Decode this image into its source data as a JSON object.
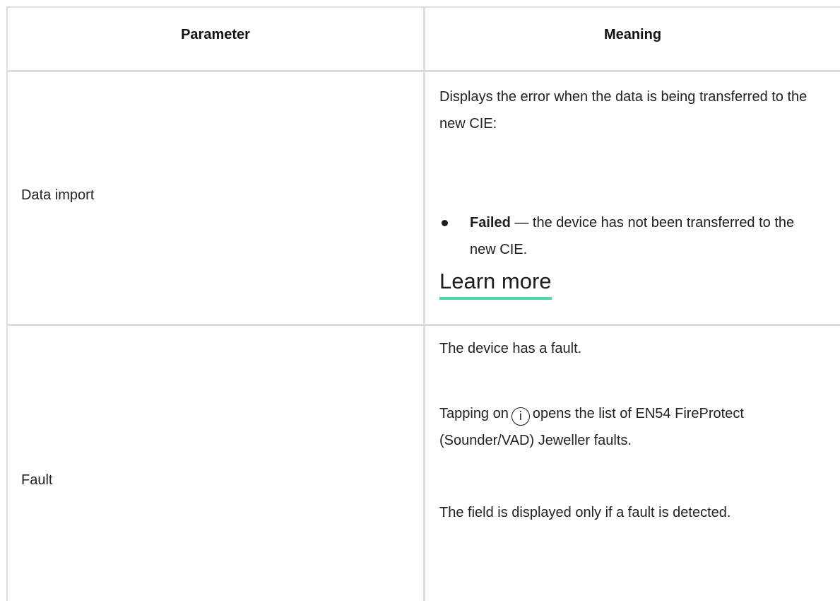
{
  "table": {
    "header": {
      "parameter": "Parameter",
      "meaning": "Meaning"
    },
    "rows": [
      {
        "parameter": "Data import",
        "meaning_intro": "Displays the error when the data is being transferred to the new CIE:",
        "bullet_term": "Failed",
        "bullet_text": " — the device has not been transferred to the new CIE.",
        "link_label": "Learn more"
      },
      {
        "parameter": "Fault",
        "meaning_line1": "The device has a fault.",
        "meaning_tap_before": "Tapping on",
        "info_icon": "info-circle-icon",
        "info_glyph": "i",
        "meaning_tap_after": "opens the list of EN54 FireProtect (Sounder/VAD) Jeweller faults.",
        "meaning_line3": "The field is displayed only if a fault is detected."
      }
    ]
  }
}
